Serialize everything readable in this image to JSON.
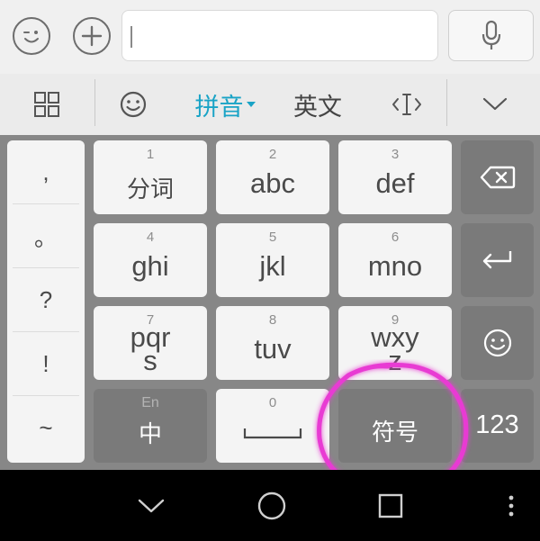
{
  "topbar": {
    "emoji_icon": "wink-face-icon",
    "add_icon": "plus-icon",
    "input_value": "",
    "mic_icon": "microphone-icon"
  },
  "toolbar": {
    "grid_icon": "grid-icon",
    "emoji_icon": "smiley-icon",
    "pinyin_label": "拼音",
    "english_label": "英文",
    "cursor_icon": "cursor-move-icon",
    "collapse_icon": "chevron-down-icon",
    "active_color": "#19a3c6"
  },
  "punctuation": [
    ",",
    "。",
    "?",
    "!",
    "~"
  ],
  "keys": {
    "k1": {
      "num": "1",
      "label": "分词"
    },
    "k2": {
      "num": "2",
      "label": "abc"
    },
    "k3": {
      "num": "3",
      "label": "def"
    },
    "k4": {
      "num": "4",
      "label": "ghi"
    },
    "k5": {
      "num": "5",
      "label": "jkl"
    },
    "k6": {
      "num": "6",
      "label": "mno"
    },
    "k7": {
      "num": "7",
      "label_line1": "pqr",
      "label_line2": "s"
    },
    "k8": {
      "num": "8",
      "label": "tuv"
    },
    "k9": {
      "num": "9",
      "label_line1": "wxy",
      "label_line2": "z"
    },
    "lang": {
      "top": "En",
      "label": "中"
    },
    "space": {
      "num": "0"
    },
    "symbols": {
      "label": "符号"
    },
    "numbers": {
      "label": "123"
    }
  },
  "side_keys": {
    "backspace_icon": "backspace-icon",
    "enter_icon": "enter-icon",
    "emoji_icon": "smiley-icon"
  },
  "navbar": {
    "back_icon": "chevron-down-icon",
    "home_icon": "circle-home-icon",
    "recents_icon": "square-recents-icon",
    "menu_icon": "more-vertical-icon"
  },
  "annotation": {
    "color": "#e83bd3"
  }
}
